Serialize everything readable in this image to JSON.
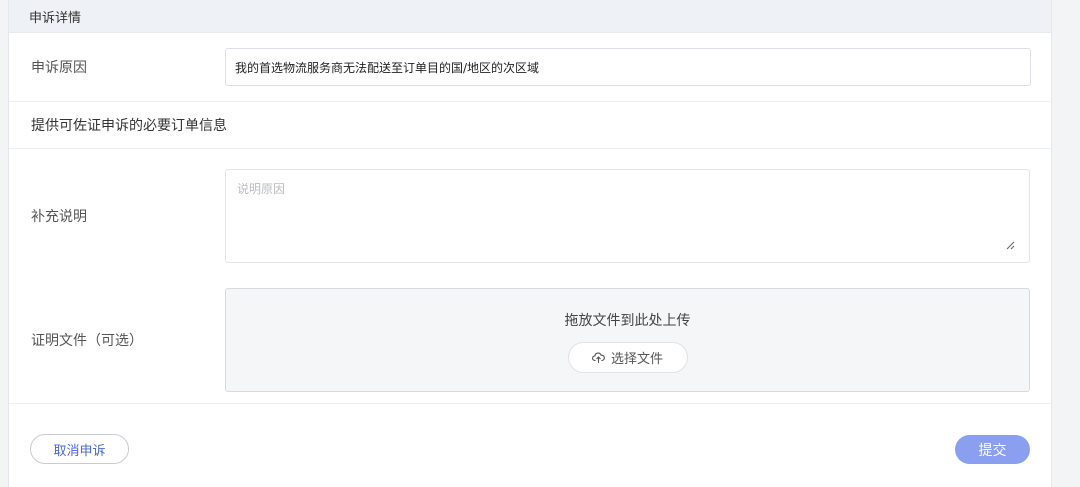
{
  "panel": {
    "header_title": "申诉详情"
  },
  "reason": {
    "label": "申诉原因",
    "value": "我的首选物流服务商无法配送至订单目的国/地区的次区域"
  },
  "section": {
    "title": "提供可佐证申诉的必要订单信息"
  },
  "supplement": {
    "label": "补充说明",
    "placeholder": "说明原因"
  },
  "proof": {
    "label": "证明文件（可选）",
    "drop_text": "拖放文件到此处上传",
    "choose_label": "选择文件"
  },
  "footer": {
    "cancel_label": "取消申诉",
    "submit_label": "提交"
  },
  "icons": {
    "upload": "upload-cloud-icon",
    "resize": "resize-handle-icon"
  },
  "colors": {
    "primary": "#8a9ff0",
    "link": "#4a66d8",
    "header_bg": "#eef1f5"
  }
}
